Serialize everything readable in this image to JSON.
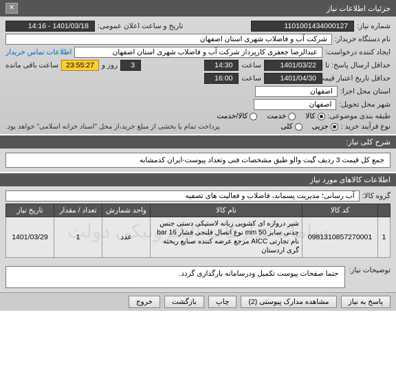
{
  "header": {
    "title": "جزئیات اطلاعات نیاز"
  },
  "form": {
    "need_number_lbl": "شماره نیاز:",
    "need_number": "1101001434000127",
    "announce_lbl": "تاریخ و ساعت اعلان عمومی:",
    "announce_val": "1401/03/18 - 14:16",
    "buyer_lbl": "نام دستگاه خریدار:",
    "buyer_val": "شرکت آب و فاضلاب شهری استان اصفهان",
    "requester_lbl": "ایجاد کننده درخواست:",
    "requester_val": "عبدالرضا جعفری کارپرداز شرکت آب و فاضلاب شهری استان اصفهان",
    "contact_link": "اطلاعات تماس خریدار",
    "deadline_lbl": "حداقل ارسال پاسخ: تا تاریخ:",
    "deadline_date": "1401/03/22",
    "time_lbl": "ساعت",
    "deadline_time": "14:30",
    "day_lbl": "روز و",
    "day_val": "3",
    "remaining_lbl": "ساعت باقی مانده",
    "remaining_val": "23:55:27",
    "valid_lbl": "حداقل تاریخ اعتبار قیمت: تا تاریخ:",
    "valid_date": "1401/04/30",
    "valid_time": "16:00",
    "exec_loc_lbl": "استان محل اجرا:",
    "exec_loc": "اصفهان",
    "deliv_loc_lbl": "شهر محل تحویل:",
    "deliv_loc": "اصفهان",
    "category_lbl": "طبقه بندی موضوعی:",
    "cat_goods": "کالا",
    "cat_service": "خدمت",
    "cat_both": "کالا/خدمت",
    "process_lbl": "نوع فرآیند خرید :",
    "proc_partial": "جزیی",
    "proc_full": "کلی",
    "process_note": "پرداخت تمام یا بخشی از مبلغ خرید،از محل \"اسناد خزانه اسلامی\" خواهد بود."
  },
  "need_desc": {
    "header": "شرح کلی نیاز:",
    "text": "جمع کل قیمت 3 ردیف گیت والو طبق مشخصات فنی وتعداد پیوست-ایران کدمشابه"
  },
  "items": {
    "header": "اطلاعات کالاهای مورد نیاز",
    "group_lbl": "گروه کالا:",
    "group_val": "آب رسانی؛ مدیریت پسماند، فاضلاب و فعالیت های تصفیه",
    "cols": [
      "",
      "کد کالا",
      "نام کالا",
      "واحد شمارش",
      "تعداد / مقدار",
      "تاریخ نیاز"
    ],
    "rows": [
      {
        "idx": "1",
        "code": "0981310857270001",
        "name": "شیر دروازه ای کشویی زبانه لاستیکی دستی جنس چدنی سایز 50 mm نوع اتصال فلنجی فشار 16 bar نام تجارتی AICC مرجع عرضه کننده صنایع ریخته گری اردستان",
        "unit": "عدد",
        "qty": "1",
        "date": "1401/03/29"
      }
    ],
    "watermark": "سامانه تدارکات الکترونیکی دولت"
  },
  "notes": {
    "lbl": "توضیحات نیاز:",
    "text": "حتما صفحات پیوست تکمیل ودرسامانه بارگذاری گردد."
  },
  "footer": {
    "back": "پاسخ به نیاز",
    "attach": "مشاهده مدارک پیوستی (2)",
    "print": "چاپ",
    "cancel": "بازگشت",
    "exit": "خروج"
  }
}
